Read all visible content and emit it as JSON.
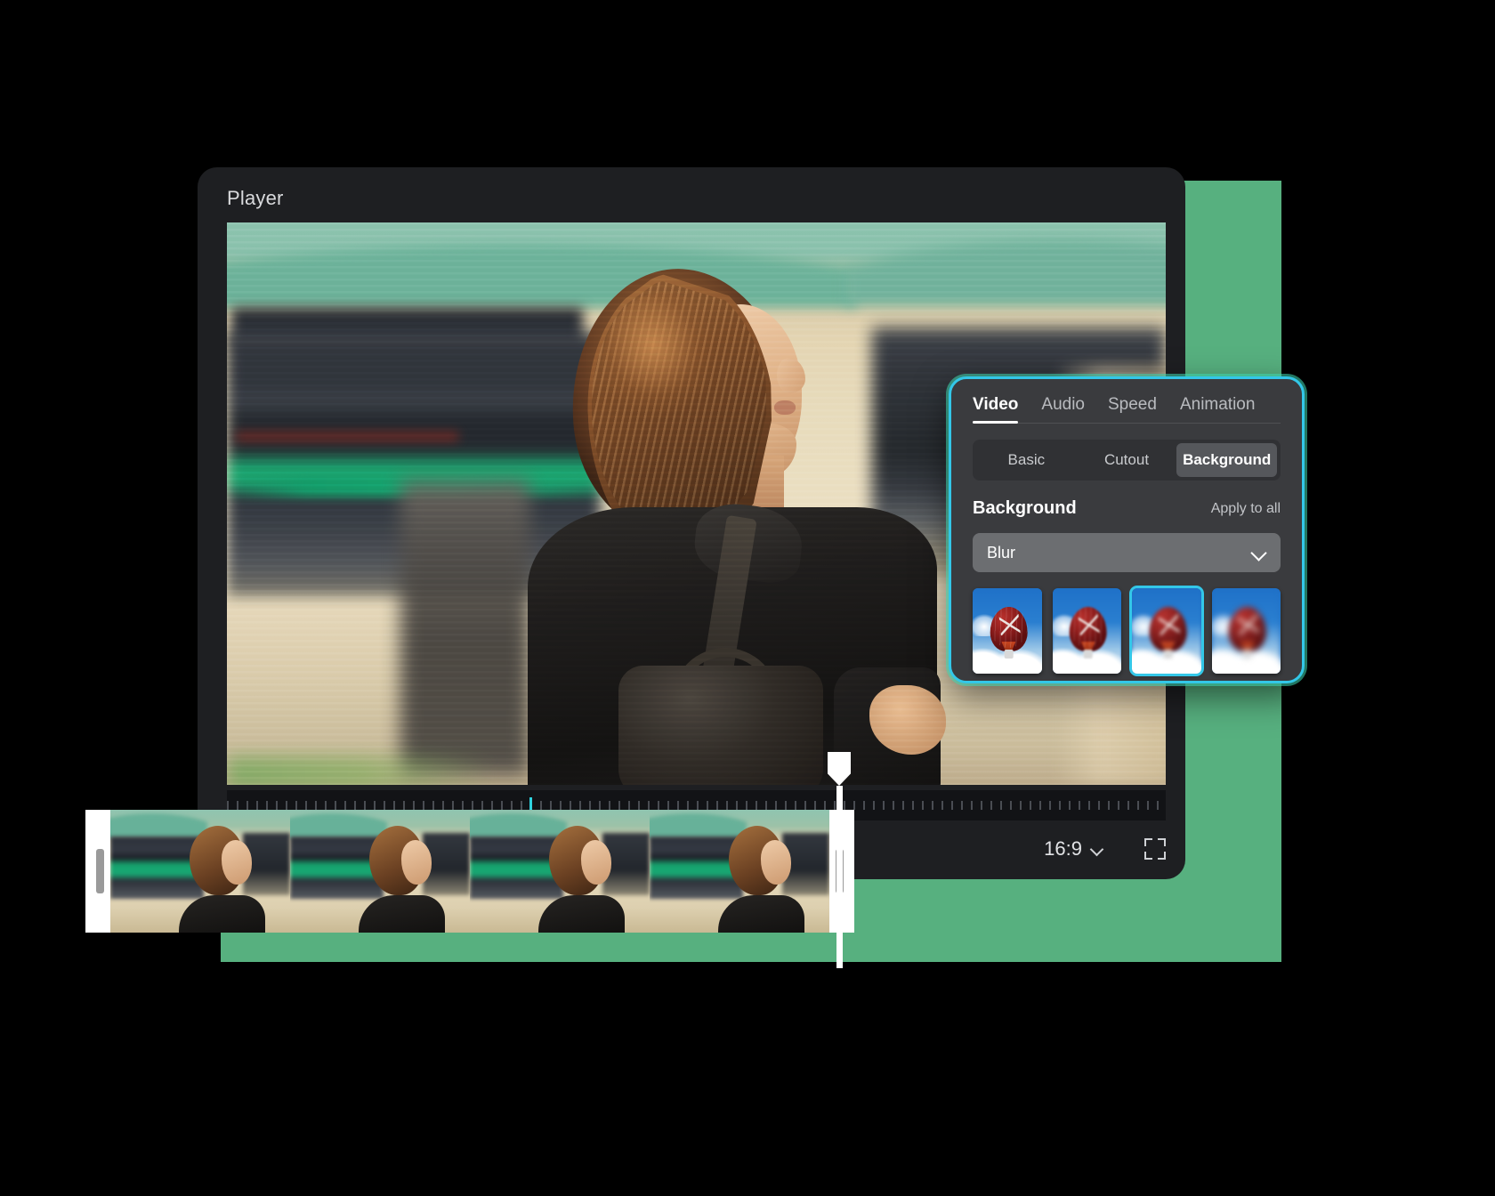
{
  "window": {
    "title": "Player"
  },
  "theme": {
    "accent_green": "#57b07f",
    "accent_cyan": "#33c7e8",
    "panel_bg": "#3a3b3e",
    "window_bg": "#1e1f22"
  },
  "player": {
    "ratio_label": "16:9",
    "ratio_chevron_icon": "chevron-down-icon",
    "fullscreen_icon": "fullscreen-icon",
    "timeline_ruler_icon": "ruler-ticks"
  },
  "properties_panel": {
    "tabs": [
      {
        "label": "Video",
        "active": true
      },
      {
        "label": "Audio",
        "active": false
      },
      {
        "label": "Speed",
        "active": false
      },
      {
        "label": "Animation",
        "active": false
      }
    ],
    "segments": [
      {
        "label": "Basic",
        "active": false
      },
      {
        "label": "Cutout",
        "active": false
      },
      {
        "label": "Background",
        "active": true
      }
    ],
    "section": {
      "title": "Background",
      "apply_to_all": "Apply to all"
    },
    "select": {
      "value": "Blur",
      "chevron_icon": "chevron-down-icon"
    },
    "thumbnails": [
      {
        "name": "blur-preset-0",
        "selected": false,
        "blur_class": "b0"
      },
      {
        "name": "blur-preset-1",
        "selected": false,
        "blur_class": "b1"
      },
      {
        "name": "blur-preset-2",
        "selected": true,
        "blur_class": "b2"
      },
      {
        "name": "blur-preset-3",
        "selected": false,
        "blur_class": "b3"
      }
    ]
  },
  "timeline": {
    "clip_name": "video-clip",
    "frame_count": 4,
    "left_handle": "trim-handle-left",
    "right_handle": "trim-handle-right",
    "playhead": "playhead"
  }
}
